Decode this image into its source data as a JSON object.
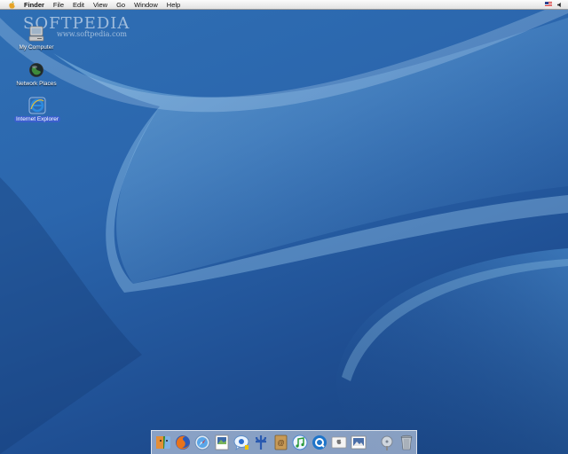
{
  "menubar": {
    "apple_icon": "apple-logo-icon",
    "items": [
      "Finder",
      "File",
      "Edit",
      "View",
      "Go",
      "Window",
      "Help"
    ],
    "status_icons": [
      "us-flag-icon",
      "speaker-icon"
    ]
  },
  "watermark": {
    "brand": "SOFTPEDIA",
    "url": "www.softpedia.com"
  },
  "desktop_icons": [
    {
      "label": "My Computer",
      "icon": "computer-icon"
    },
    {
      "label": "Network Places",
      "icon": "network-globe-icon"
    },
    {
      "label": "Internet Explorer",
      "icon": "internet-explorer-icon",
      "selected": true
    }
  ],
  "dock": {
    "apps": [
      "finder-icon",
      "firefox-icon",
      "safari-icon",
      "preview-icon",
      "ichat-icon",
      "system-preferences-icon",
      "address-book-icon",
      "itunes-icon",
      "quicktime-icon",
      "apple-site-icon",
      "iphoto-icon"
    ],
    "trailing": [
      "disk-utility-icon",
      "trash-icon"
    ]
  },
  "colors": {
    "wallpaper_top": "#2f6fb4",
    "wallpaper_bottom": "#17417e",
    "selection": "#3a5fcd",
    "menubar": "#ececec"
  }
}
